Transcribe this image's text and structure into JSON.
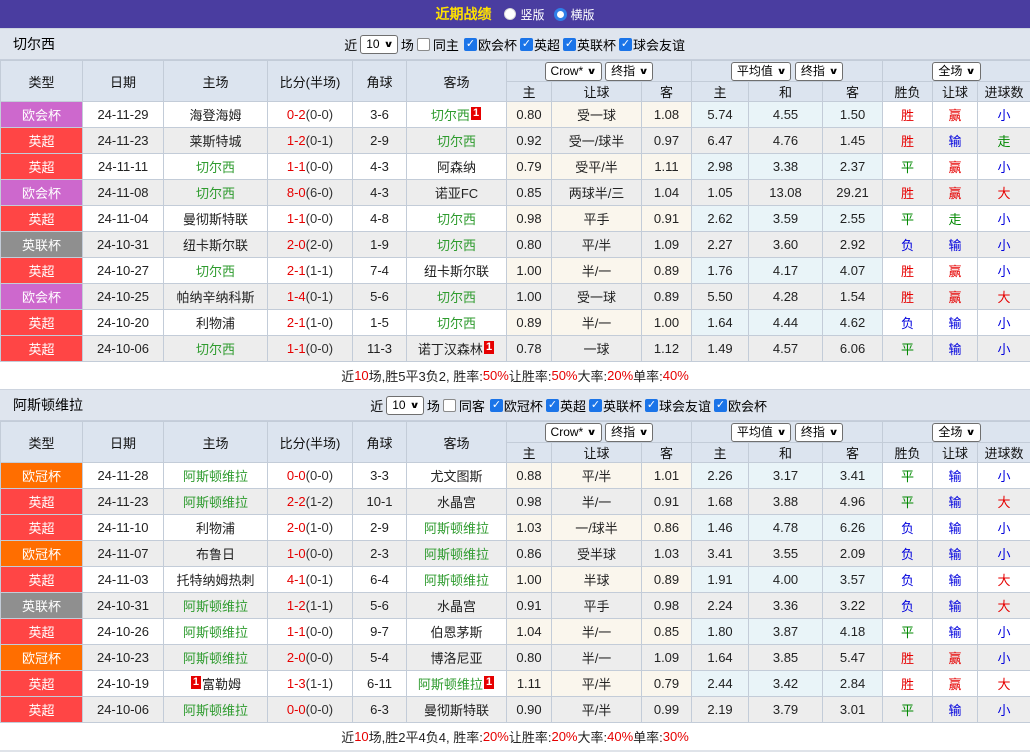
{
  "topbar": {
    "title": "近期战绩",
    "layout_options": [
      {
        "label": "竖版",
        "selected": false
      },
      {
        "label": "横版",
        "selected": true
      }
    ]
  },
  "table_header": {
    "static_cols": [
      "类型",
      "日期",
      "主场",
      "比分(半场)",
      "角球",
      "客场"
    ],
    "selects": {
      "odds_source": "Crow*",
      "odds_final": "终指",
      "average": "平均值",
      "average_final": "终指",
      "fulltime": "全场"
    },
    "odds_cols": [
      "主",
      "让球",
      "客"
    ],
    "avg_cols": [
      "主",
      "和",
      "客"
    ],
    "result_cols": [
      "胜负",
      "让球",
      "进球数"
    ]
  },
  "colors": {
    "topbar_bg": "#4a3da0",
    "title_yellow": "#ffe100",
    "header_bg": "#dce4ef",
    "league": {
      "epl": "#ff4545",
      "uecl": "#cd68cd",
      "ucl": "#ff6e00",
      "eflc": "#8f8f8f"
    },
    "result": {
      "r": "#e60000",
      "g": "#008800",
      "b": "#0000dd"
    },
    "team_green": "#2e9b2e",
    "score_red": "#e60000",
    "badge_red": "#e60000",
    "checkbox_blue": "#1b74e8"
  },
  "sections": [
    {
      "team": "切尔西",
      "filter": {
        "near_label": "近",
        "count": "10",
        "games_label": "场",
        "same_checked": false,
        "same_label": "同主",
        "leagues": [
          {
            "label": "欧会杯",
            "checked": true
          },
          {
            "label": "英超",
            "checked": true
          },
          {
            "label": "英联杯",
            "checked": true
          },
          {
            "label": "球会友谊",
            "checked": true
          }
        ]
      },
      "rows": [
        {
          "league": "欧会杯",
          "lk": "uecl",
          "date": "24-11-29",
          "home": {
            "t": "海登海姆"
          },
          "score": "0-2",
          "half": "(0-0)",
          "corner": "3-6",
          "away": {
            "t": "切尔西",
            "major": true,
            "badge": "1"
          },
          "crown": [
            "0.80",
            "受一球",
            "1.08"
          ],
          "avg": [
            "5.74",
            "4.55",
            "1.50"
          ],
          "res": [
            [
              "胜",
              "r"
            ],
            [
              "赢",
              "r"
            ],
            [
              "小",
              "b"
            ]
          ]
        },
        {
          "league": "英超",
          "lk": "epl",
          "date": "24-11-23",
          "home": {
            "t": "莱斯特城"
          },
          "score": "1-2",
          "half": "(0-1)",
          "corner": "2-9",
          "away": {
            "t": "切尔西",
            "major": true
          },
          "crown": [
            "0.92",
            "受一/球半",
            "0.97"
          ],
          "avg": [
            "6.47",
            "4.76",
            "1.45"
          ],
          "res": [
            [
              "胜",
              "r"
            ],
            [
              "输",
              "b"
            ],
            [
              "走",
              "g"
            ]
          ]
        },
        {
          "league": "英超",
          "lk": "epl",
          "date": "24-11-11",
          "home": {
            "t": "切尔西",
            "major": true
          },
          "score": "1-1",
          "half": "(0-0)",
          "corner": "4-3",
          "away": {
            "t": "阿森纳"
          },
          "crown": [
            "0.79",
            "受平/半",
            "1.11"
          ],
          "avg": [
            "2.98",
            "3.38",
            "2.37"
          ],
          "res": [
            [
              "平",
              "g"
            ],
            [
              "赢",
              "r"
            ],
            [
              "小",
              "b"
            ]
          ]
        },
        {
          "league": "欧会杯",
          "lk": "uecl",
          "date": "24-11-08",
          "home": {
            "t": "切尔西",
            "major": true
          },
          "score": "8-0",
          "half": "(6-0)",
          "corner": "4-3",
          "away": {
            "t": "诺亚FC"
          },
          "crown": [
            "0.85",
            "两球半/三",
            "1.04"
          ],
          "avg": [
            "1.05",
            "13.08",
            "29.21"
          ],
          "res": [
            [
              "胜",
              "r"
            ],
            [
              "赢",
              "r"
            ],
            [
              "大",
              "r"
            ]
          ]
        },
        {
          "league": "英超",
          "lk": "epl",
          "date": "24-11-04",
          "home": {
            "t": "曼彻斯特联"
          },
          "score": "1-1",
          "half": "(0-0)",
          "corner": "4-8",
          "away": {
            "t": "切尔西",
            "major": true
          },
          "crown": [
            "0.98",
            "平手",
            "0.91"
          ],
          "avg": [
            "2.62",
            "3.59",
            "2.55"
          ],
          "res": [
            [
              "平",
              "g"
            ],
            [
              "走",
              "g"
            ],
            [
              "小",
              "b"
            ]
          ]
        },
        {
          "league": "英联杯",
          "lk": "eflc",
          "date": "24-10-31",
          "home": {
            "t": "纽卡斯尔联"
          },
          "score": "2-0",
          "half": "(2-0)",
          "corner": "1-9",
          "away": {
            "t": "切尔西",
            "major": true
          },
          "crown": [
            "0.80",
            "平/半",
            "1.09"
          ],
          "avg": [
            "2.27",
            "3.60",
            "2.92"
          ],
          "res": [
            [
              "负",
              "b"
            ],
            [
              "输",
              "b"
            ],
            [
              "小",
              "b"
            ]
          ]
        },
        {
          "league": "英超",
          "lk": "epl",
          "date": "24-10-27",
          "home": {
            "t": "切尔西",
            "major": true
          },
          "score": "2-1",
          "half": "(1-1)",
          "corner": "7-4",
          "away": {
            "t": "纽卡斯尔联"
          },
          "crown": [
            "1.00",
            "半/一",
            "0.89"
          ],
          "avg": [
            "1.76",
            "4.17",
            "4.07"
          ],
          "res": [
            [
              "胜",
              "r"
            ],
            [
              "赢",
              "r"
            ],
            [
              "小",
              "b"
            ]
          ]
        },
        {
          "league": "欧会杯",
          "lk": "uecl",
          "date": "24-10-25",
          "home": {
            "t": "帕纳辛纳科斯"
          },
          "score": "1-4",
          "half": "(0-1)",
          "corner": "5-6",
          "away": {
            "t": "切尔西",
            "major": true
          },
          "crown": [
            "1.00",
            "受一球",
            "0.89"
          ],
          "avg": [
            "5.50",
            "4.28",
            "1.54"
          ],
          "res": [
            [
              "胜",
              "r"
            ],
            [
              "赢",
              "r"
            ],
            [
              "大",
              "r"
            ]
          ]
        },
        {
          "league": "英超",
          "lk": "epl",
          "date": "24-10-20",
          "home": {
            "t": "利物浦"
          },
          "score": "2-1",
          "half": "(1-0)",
          "corner": "1-5",
          "away": {
            "t": "切尔西",
            "major": true
          },
          "crown": [
            "0.89",
            "半/一",
            "1.00"
          ],
          "avg": [
            "1.64",
            "4.44",
            "4.62"
          ],
          "res": [
            [
              "负",
              "b"
            ],
            [
              "输",
              "b"
            ],
            [
              "小",
              "b"
            ]
          ]
        },
        {
          "league": "英超",
          "lk": "epl",
          "date": "24-10-06",
          "home": {
            "t": "切尔西",
            "major": true
          },
          "score": "1-1",
          "half": "(0-0)",
          "corner": "11-3",
          "away": {
            "t": "诺丁汉森林",
            "badge": "1"
          },
          "crown": [
            "0.78",
            "一球",
            "1.12"
          ],
          "avg": [
            "1.49",
            "4.57",
            "6.06"
          ],
          "res": [
            [
              "平",
              "g"
            ],
            [
              "输",
              "b"
            ],
            [
              "小",
              "b"
            ]
          ]
        }
      ],
      "summary": [
        [
          "近",
          "k"
        ],
        [
          "10",
          "r"
        ],
        [
          "场,胜5平3负2, 胜率:",
          "k"
        ],
        [
          "50%",
          "r"
        ],
        [
          " 让胜率:",
          "k"
        ],
        [
          "50%",
          "r"
        ],
        [
          " 大率:",
          "k"
        ],
        [
          "20%",
          "r"
        ],
        [
          " 单率:",
          "k"
        ],
        [
          "40%",
          "r"
        ]
      ]
    },
    {
      "team": "阿斯顿维拉",
      "filter": {
        "near_label": "近",
        "count": "10",
        "games_label": "场",
        "same_checked": false,
        "same_label": "同客",
        "leagues": [
          {
            "label": "欧冠杯",
            "checked": true
          },
          {
            "label": "英超",
            "checked": true
          },
          {
            "label": "英联杯",
            "checked": true
          },
          {
            "label": "球会友谊",
            "checked": true
          },
          {
            "label": "欧会杯",
            "checked": true
          }
        ]
      },
      "rows": [
        {
          "league": "欧冠杯",
          "lk": "ucl",
          "date": "24-11-28",
          "home": {
            "t": "阿斯顿维拉",
            "major": true
          },
          "score": "0-0",
          "half": "(0-0)",
          "corner": "3-3",
          "away": {
            "t": "尤文图斯"
          },
          "crown": [
            "0.88",
            "平/半",
            "1.01"
          ],
          "avg": [
            "2.26",
            "3.17",
            "3.41"
          ],
          "res": [
            [
              "平",
              "g"
            ],
            [
              "输",
              "b"
            ],
            [
              "小",
              "b"
            ]
          ]
        },
        {
          "league": "英超",
          "lk": "epl",
          "date": "24-11-23",
          "home": {
            "t": "阿斯顿维拉",
            "major": true
          },
          "score": "2-2",
          "half": "(1-2)",
          "corner": "10-1",
          "away": {
            "t": "水晶宫"
          },
          "crown": [
            "0.98",
            "半/一",
            "0.91"
          ],
          "avg": [
            "1.68",
            "3.88",
            "4.96"
          ],
          "res": [
            [
              "平",
              "g"
            ],
            [
              "输",
              "b"
            ],
            [
              "大",
              "r"
            ]
          ]
        },
        {
          "league": "英超",
          "lk": "epl",
          "date": "24-11-10",
          "home": {
            "t": "利物浦"
          },
          "score": "2-0",
          "half": "(1-0)",
          "corner": "2-9",
          "away": {
            "t": "阿斯顿维拉",
            "major": true
          },
          "crown": [
            "1.03",
            "一/球半",
            "0.86"
          ],
          "avg": [
            "1.46",
            "4.78",
            "6.26"
          ],
          "res": [
            [
              "负",
              "b"
            ],
            [
              "输",
              "b"
            ],
            [
              "小",
              "b"
            ]
          ]
        },
        {
          "league": "欧冠杯",
          "lk": "ucl",
          "date": "24-11-07",
          "home": {
            "t": "布鲁日"
          },
          "score": "1-0",
          "half": "(0-0)",
          "corner": "2-3",
          "away": {
            "t": "阿斯顿维拉",
            "major": true
          },
          "crown": [
            "0.86",
            "受半球",
            "1.03"
          ],
          "avg": [
            "3.41",
            "3.55",
            "2.09"
          ],
          "res": [
            [
              "负",
              "b"
            ],
            [
              "输",
              "b"
            ],
            [
              "小",
              "b"
            ]
          ]
        },
        {
          "league": "英超",
          "lk": "epl",
          "date": "24-11-03",
          "home": {
            "t": "托特纳姆热刺"
          },
          "score": "4-1",
          "half": "(0-1)",
          "corner": "6-4",
          "away": {
            "t": "阿斯顿维拉",
            "major": true
          },
          "crown": [
            "1.00",
            "半球",
            "0.89"
          ],
          "avg": [
            "1.91",
            "4.00",
            "3.57"
          ],
          "res": [
            [
              "负",
              "b"
            ],
            [
              "输",
              "b"
            ],
            [
              "大",
              "r"
            ]
          ]
        },
        {
          "league": "英联杯",
          "lk": "eflc",
          "date": "24-10-31",
          "home": {
            "t": "阿斯顿维拉",
            "major": true
          },
          "score": "1-2",
          "half": "(1-1)",
          "corner": "5-6",
          "away": {
            "t": "水晶宫"
          },
          "crown": [
            "0.91",
            "平手",
            "0.98"
          ],
          "avg": [
            "2.24",
            "3.36",
            "3.22"
          ],
          "res": [
            [
              "负",
              "b"
            ],
            [
              "输",
              "b"
            ],
            [
              "大",
              "r"
            ]
          ]
        },
        {
          "league": "英超",
          "lk": "epl",
          "date": "24-10-26",
          "home": {
            "t": "阿斯顿维拉",
            "major": true
          },
          "score": "1-1",
          "half": "(0-0)",
          "corner": "9-7",
          "away": {
            "t": "伯恩茅斯"
          },
          "crown": [
            "1.04",
            "半/一",
            "0.85"
          ],
          "avg": [
            "1.80",
            "3.87",
            "4.18"
          ],
          "res": [
            [
              "平",
              "g"
            ],
            [
              "输",
              "b"
            ],
            [
              "小",
              "b"
            ]
          ]
        },
        {
          "league": "欧冠杯",
          "lk": "ucl",
          "date": "24-10-23",
          "home": {
            "t": "阿斯顿维拉",
            "major": true
          },
          "score": "2-0",
          "half": "(0-0)",
          "corner": "5-4",
          "away": {
            "t": "博洛尼亚"
          },
          "crown": [
            "0.80",
            "半/一",
            "1.09"
          ],
          "avg": [
            "1.64",
            "3.85",
            "5.47"
          ],
          "res": [
            [
              "胜",
              "r"
            ],
            [
              "赢",
              "r"
            ],
            [
              "小",
              "b"
            ]
          ]
        },
        {
          "league": "英超",
          "lk": "epl",
          "date": "24-10-19",
          "home": {
            "t": "富勒姆",
            "badge_pre": "1"
          },
          "score": "1-3",
          "half": "(1-1)",
          "corner": "6-11",
          "away": {
            "t": "阿斯顿维拉",
            "major": true,
            "badge": "1"
          },
          "crown": [
            "1.11",
            "平/半",
            "0.79"
          ],
          "avg": [
            "2.44",
            "3.42",
            "2.84"
          ],
          "res": [
            [
              "胜",
              "r"
            ],
            [
              "赢",
              "r"
            ],
            [
              "大",
              "r"
            ]
          ]
        },
        {
          "league": "英超",
          "lk": "epl",
          "date": "24-10-06",
          "home": {
            "t": "阿斯顿维拉",
            "major": true
          },
          "score": "0-0",
          "half": "(0-0)",
          "corner": "6-3",
          "away": {
            "t": "曼彻斯特联"
          },
          "crown": [
            "0.90",
            "平/半",
            "0.99"
          ],
          "avg": [
            "2.19",
            "3.79",
            "3.01"
          ],
          "res": [
            [
              "平",
              "g"
            ],
            [
              "输",
              "b"
            ],
            [
              "小",
              "b"
            ]
          ]
        }
      ],
      "summary": [
        [
          "近",
          "k"
        ],
        [
          "10",
          "r"
        ],
        [
          "场,胜2平4负4, 胜率:",
          "k"
        ],
        [
          "20%",
          "r"
        ],
        [
          " 让胜率:",
          "k"
        ],
        [
          "20%",
          "r"
        ],
        [
          " 大率:",
          "k"
        ],
        [
          "40%",
          "r"
        ],
        [
          " 单率:",
          "k"
        ],
        [
          "30%",
          "r"
        ]
      ]
    }
  ]
}
